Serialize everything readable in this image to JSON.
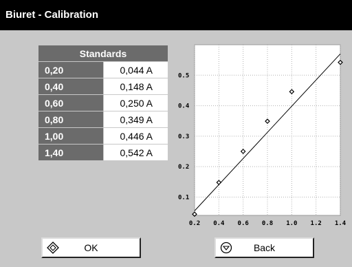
{
  "window": {
    "title": "Biuret - Calibration"
  },
  "table": {
    "header": "Standards",
    "rows": [
      {
        "conc": "0,20",
        "abs": "0,044 A"
      },
      {
        "conc": "0,40",
        "abs": "0,148 A"
      },
      {
        "conc": "0,60",
        "abs": "0,250 A"
      },
      {
        "conc": "0,80",
        "abs": "0,349 A"
      },
      {
        "conc": "1,00",
        "abs": "0,446 A"
      },
      {
        "conc": "1,40",
        "abs": "0,542 A"
      }
    ]
  },
  "chart_data": {
    "type": "scatter",
    "x_ticks": [
      "0.2",
      "0.4",
      "0.6",
      "0.8",
      "1.0",
      "1.2",
      "1.4"
    ],
    "y_ticks": [
      "0.1",
      "0.2",
      "0.3",
      "0.4",
      "0.5"
    ],
    "xlim": [
      0.2,
      1.4
    ],
    "ylim": [
      0.04,
      0.6
    ],
    "grid": true,
    "points": [
      {
        "x": 0.2,
        "y": 0.044
      },
      {
        "x": 0.4,
        "y": 0.148
      },
      {
        "x": 0.6,
        "y": 0.25
      },
      {
        "x": 0.8,
        "y": 0.349
      },
      {
        "x": 1.0,
        "y": 0.446
      },
      {
        "x": 1.4,
        "y": 0.542
      }
    ],
    "fit_line": {
      "x": [
        0.2,
        1.4
      ],
      "y": [
        0.055,
        0.57
      ]
    }
  },
  "buttons": {
    "ok_label": "OK",
    "back_label": "Back"
  }
}
